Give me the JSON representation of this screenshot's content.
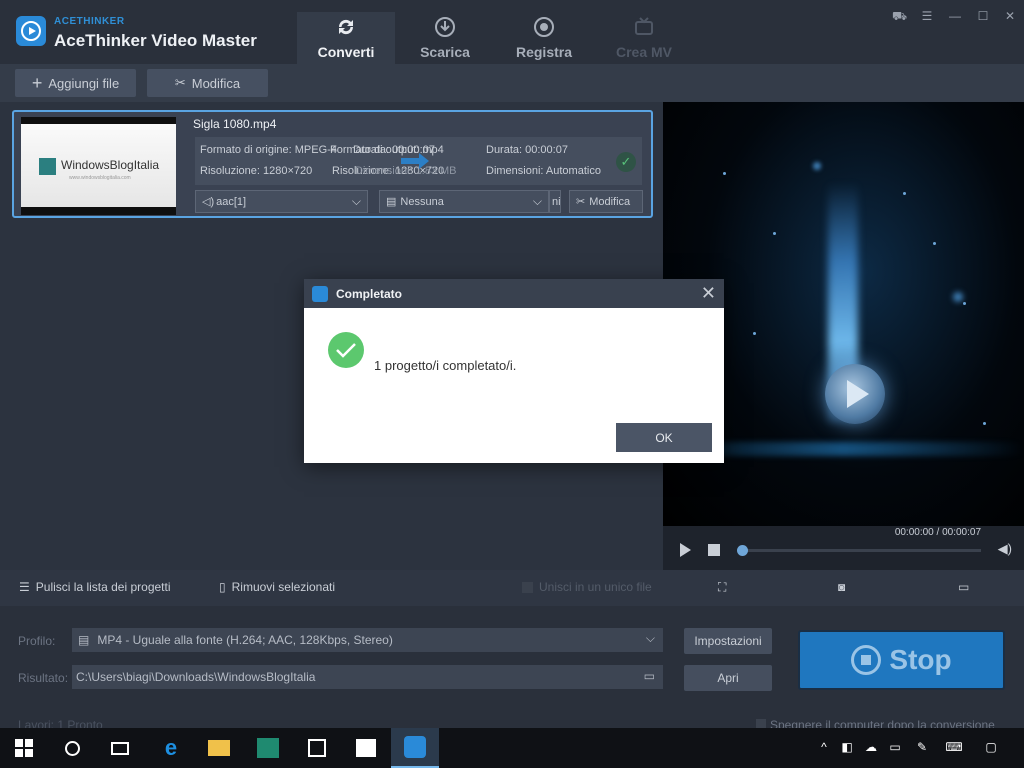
{
  "app": {
    "brand_small": "ACETHINKER",
    "brand_title": "AceThinker Video Master",
    "tabs": [
      {
        "label": "Converti",
        "icon": "refresh-icon"
      },
      {
        "label": "Scarica",
        "icon": "download-icon"
      },
      {
        "label": "Registra",
        "icon": "record-icon"
      },
      {
        "label": "Crea MV",
        "icon": "tv-icon"
      }
    ]
  },
  "toolbar": {
    "add_files": "Aggiungi file",
    "edit": "Modifica"
  },
  "file": {
    "name": "Sigla 1080.mp4",
    "thumb_text": "WindowsBlogItalia",
    "thumb_sub": "www.windowsblogitalia.com",
    "source_format": "Formato di origine: MPEG-4",
    "output_format_ghost": "Formato di output: mp4",
    "duration_ghost": "Durata: 00:00:07",
    "source_resolution": "Risoluzione: 1280×720",
    "output_resolution_ghost": "Risoluzione: 1280×720",
    "dimensions_ghost": "Dimensioni: 1.83 MB",
    "duration": "Durata: 00:00:07",
    "dimensions": "Dimensioni: Automatico",
    "audio_track": "aac[1]",
    "subtitle": "Nessuna",
    "trim_btn_partial": "ni",
    "edit_btn": "Modifica"
  },
  "preview": {
    "timecode": "00:00:00 / 00:00:07"
  },
  "strip": {
    "clear_list": "Pulisci la lista dei progetti",
    "remove_selected": "Rimuovi selezionati",
    "merge": "Unisci in un unico file"
  },
  "settings": {
    "profile_label": "Profilo:",
    "profile_value": "MP4 - Uguale alla fonte (H.264; AAC, 128Kbps, Stereo)",
    "settings_btn": "Impostazioni",
    "output_label": "Risultato:",
    "output_value": "C:\\Users\\biagi\\Downloads\\WindowsBlogItalia",
    "open_btn": "Apri",
    "stop_btn": "Stop",
    "jobs_partial": "Lavori: 1     Pronto",
    "shutdown_partial": "Spegnere il computer dopo la conversione"
  },
  "modal": {
    "title": "Completato",
    "message": "1 progetto/i completato/i.",
    "ok": "OK"
  },
  "colors": {
    "accent": "#2a8ad8",
    "stop": "#1f77bf",
    "success": "#5cc86e"
  }
}
